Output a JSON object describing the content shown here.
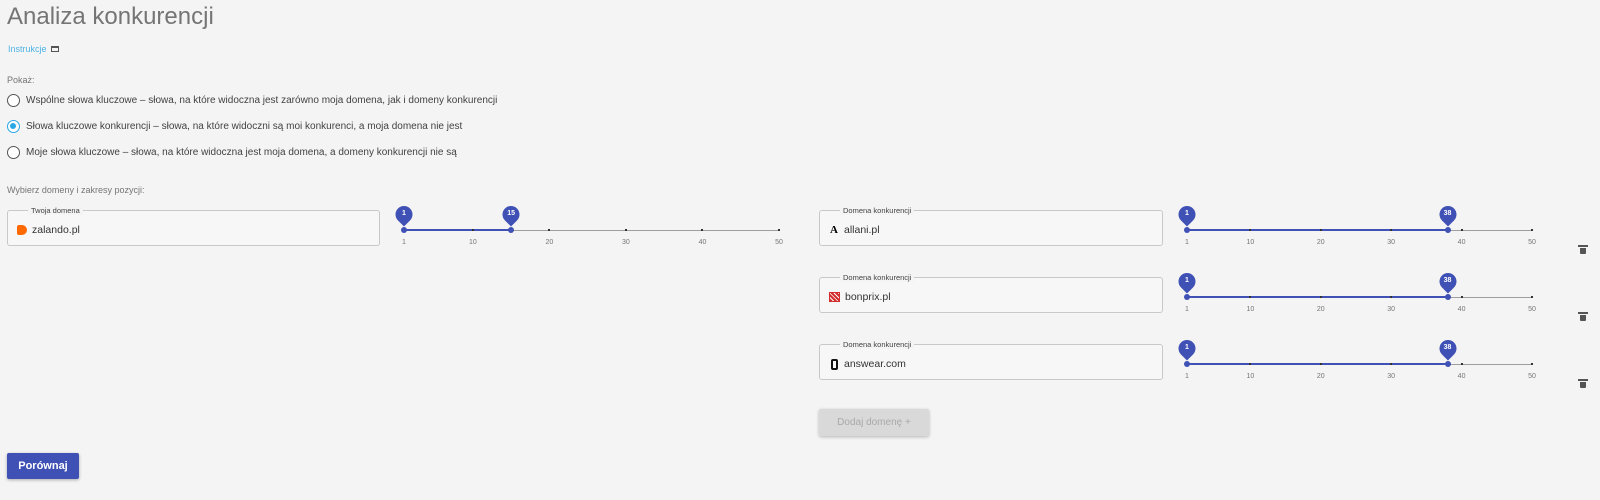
{
  "page": {
    "title": "Analiza konkurencji",
    "instructions_link": "Instrukcje"
  },
  "show": {
    "label": "Pokaż:",
    "options": [
      {
        "label": "Wspólne słowa kluczowe – słowa, na które widoczna jest zarówno moja domena, jak i domeny konkurencji",
        "checked": false
      },
      {
        "label": "Słowa kluczowe konkurencji – słowa, na które widoczni są moi konkurenci, a moja domena nie jest",
        "checked": true
      },
      {
        "label": "Moje słowa kluczowe – słowa, na które widoczna jest moja domena, a domeny konkurencji nie są",
        "checked": false
      }
    ]
  },
  "domains": {
    "label": "Wybierz domeny i zakresy pozycji:",
    "own": {
      "legend": "Twoja domena",
      "value": "zalando.pl",
      "range": [
        1,
        15
      ]
    },
    "competitors": [
      {
        "legend": "Domena konkurencji",
        "value": "allani.pl",
        "range": [
          1,
          38
        ]
      },
      {
        "legend": "Domena konkurencji",
        "value": "bonprix.pl",
        "range": [
          1,
          38
        ]
      },
      {
        "legend": "Domena konkurencji",
        "value": "answear.com",
        "range": [
          1,
          38
        ]
      }
    ],
    "slider_ticks": [
      "1",
      "10",
      "20",
      "30",
      "40",
      "50"
    ],
    "slider_min": 1,
    "slider_max": 50,
    "add_button": "Dodaj domenę +"
  },
  "actions": {
    "compare_button": "Porównaj"
  },
  "colors": {
    "accent": "#3f51b5",
    "radio_checked": "#2aa8e6",
    "link": "#4fb3e6",
    "zalando_logo": "#ff6900"
  }
}
